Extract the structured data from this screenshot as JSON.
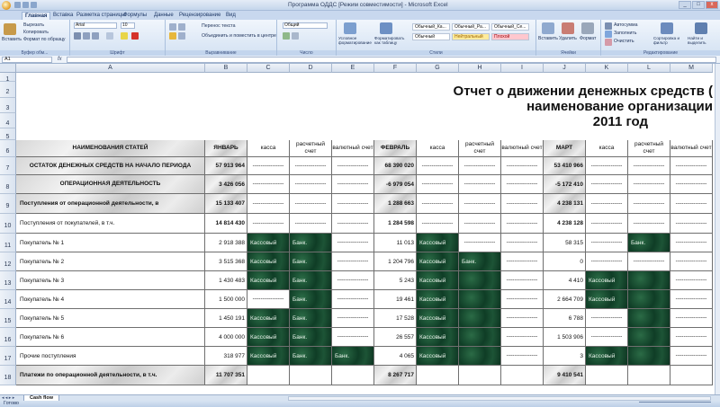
{
  "window": {
    "title": "Программа ОДДС [Режим совместимости] - Microsoft Excel",
    "buttons": [
      "_",
      "□",
      "x"
    ]
  },
  "ribbon_tabs": [
    {
      "label": "Главная",
      "active": true
    },
    {
      "label": "Вставка"
    },
    {
      "label": "Разметка страницы"
    },
    {
      "label": "Формулы"
    },
    {
      "label": "Данные"
    },
    {
      "label": "Рецензирование"
    },
    {
      "label": "Вид"
    }
  ],
  "ribbon": {
    "clipboard": {
      "paste": "Вставить",
      "cut": "Вырезать",
      "copy": "Копировать",
      "format_painter": "Формат по образцу",
      "label": "Буфер обм..."
    },
    "font": {
      "name": "Arial",
      "size": "10",
      "label": "Шрифт"
    },
    "alignment": {
      "wrap": "Перенос текста",
      "merge": "Объединить и поместить в центре",
      "label": "Выравнивание"
    },
    "number": {
      "format": "Общий",
      "label": "Число"
    },
    "styles": {
      "conditional": "Условное форматирование",
      "as_table": "Форматировать как таблицу",
      "cells": [
        "Обычный_Ка...",
        "Обычный_Ра...",
        "Обычный_Се...",
        "Обычный",
        "Нейтральный",
        "Плохой"
      ],
      "label": "Стили"
    },
    "cells": {
      "insert": "Вставить",
      "delete": "Удалить",
      "format": "Формат",
      "label": "Ячейки"
    },
    "editing": {
      "autosum": "Автосумма",
      "fill": "Заполнить",
      "clear": "Очистить",
      "sort": "Сортировка и фильтр",
      "find": "Найти и выделить",
      "label": "Редактирование"
    }
  },
  "formula_bar": {
    "name_box": "A1",
    "fx": "fx",
    "formula": ""
  },
  "columns": [
    "A",
    "B",
    "C",
    "D",
    "E",
    "F",
    "G",
    "H",
    "I",
    "J",
    "K",
    "L",
    "M"
  ],
  "rows": [
    "1",
    "2",
    "3",
    "4",
    "5",
    "6",
    "7",
    "8",
    "9",
    "10",
    "11",
    "12",
    "13",
    "14",
    "15",
    "16",
    "17",
    "18"
  ],
  "report": {
    "title_line1": "Отчет о движении денежных средств (",
    "title_line2": "наименование организации",
    "title_line3": "2011 год"
  },
  "headers": {
    "item": "НАИМЕНОВАНИЯ СТАТЕЙ",
    "jan": "ЯНВАРЬ",
    "feb": "ФЕВРАЛЬ",
    "mar": "МАРТ",
    "cash": "касса",
    "settlement": "расчетный счет",
    "currency": "валютный счет"
  },
  "table_rows": [
    {
      "label": "ОСТАТОК ДЕНЕЖНЫХ СРЕДСТВ НА НАЧАЛО ПЕРИОДА",
      "jan": "57 913 964",
      "feb": "68 390 020",
      "mar": "53 410 966",
      "style": "header"
    },
    {
      "label": "ОПЕРАЦИОННАЯ ДЕЯТЕЛЬНОСТЬ",
      "jan": "3 426 056",
      "feb": "-6 979 054",
      "mar": "-5 172 410",
      "style": "header"
    },
    {
      "label": "Поступления от операционной деятельности, в",
      "jan": "15 133 407",
      "feb": "1 288 663",
      "mar": "4 238 131",
      "style": "sub"
    },
    {
      "label": "Поступления от покупателей, в т.ч.",
      "jan": "14 814 430",
      "feb": "1 284 598",
      "mar": "4 238 128",
      "style": "sub2"
    },
    {
      "label": "Покупатель № 1",
      "jan": "2 918 388",
      "feb": "11 013",
      "mar": "58 315"
    },
    {
      "label": "Покупатель № 2",
      "jan": "3 515 368",
      "feb": "1 204 796",
      "mar": "0"
    },
    {
      "label": "Покупатель № 3",
      "jan": "1 430 483",
      "feb": "5 243",
      "mar": "4 410"
    },
    {
      "label": "Покупатель № 4",
      "jan": "1 500 000",
      "feb": "19 461",
      "mar": "2 664 709"
    },
    {
      "label": "Покупатель № 5",
      "jan": "1 450 191",
      "feb": "17 528",
      "mar": "6 788"
    },
    {
      "label": "Покупатель № 6",
      "jan": "4 000 000",
      "feb": "26 557",
      "mar": "1 503 906"
    },
    {
      "label": "Прочие поступления",
      "jan": "318 977",
      "feb": "4 065",
      "mar": "3"
    },
    {
      "label": "Платежи по операционной деятельности, в т.ч.",
      "jan": "11 707 351",
      "feb": "8 267 717",
      "mar": "9 410 541",
      "style": "sub"
    }
  ],
  "cell_texts": {
    "dash": "----------------",
    "kassa": "Кассовый",
    "bank": "Банк."
  },
  "sheet": {
    "tab": "Cash flow",
    "status": "Готово"
  }
}
